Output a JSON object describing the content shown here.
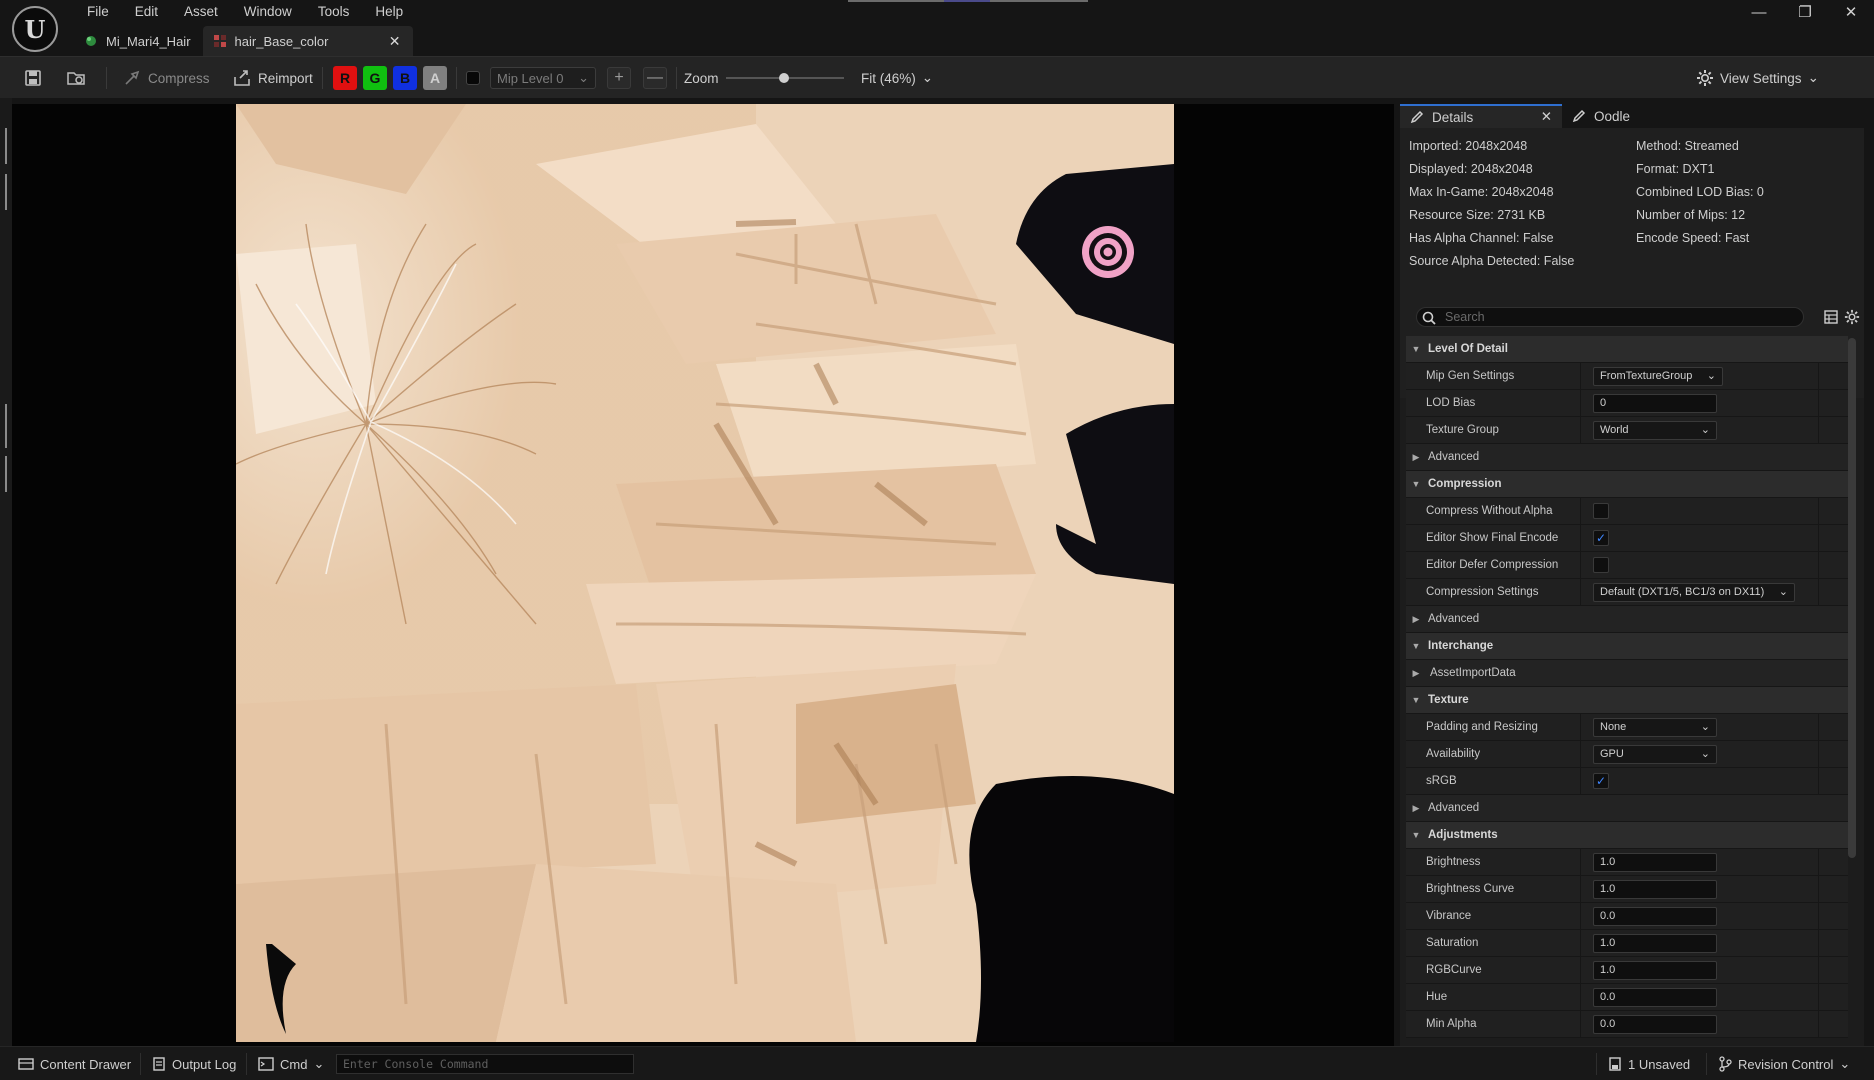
{
  "menu": [
    "File",
    "Edit",
    "Asset",
    "Window",
    "Tools",
    "Help"
  ],
  "tabs": [
    {
      "label": "Mi_Mari4_Hair",
      "active": false
    },
    {
      "label": "hair_Base_color",
      "active": true
    }
  ],
  "toolbar": {
    "compress": "Compress",
    "reimport": "Reimport",
    "channels": [
      "R",
      "G",
      "B",
      "A"
    ],
    "channel_colors": [
      "#e01010",
      "#10c010",
      "#1030e0",
      "#808080"
    ],
    "mip_level": "Mip Level 0",
    "zoom_label": "Zoom",
    "zoom_value": 0.46,
    "fit": "Fit (46%)",
    "view_settings": "View Settings"
  },
  "details_tabs": [
    "Details",
    "Oodle"
  ],
  "stats": {
    "imported": "Imported: 2048x2048",
    "displayed": "Displayed: 2048x2048",
    "max_in_game": "Max In-Game: 2048x2048",
    "resource_size": "Resource Size: 2731 KB",
    "has_alpha": "Has Alpha Channel: False",
    "source_alpha": "Source Alpha Detected: False",
    "method": "Method: Streamed",
    "format": "Format: DXT1",
    "lod_bias": "Combined LOD Bias: 0",
    "num_mips": "Number of Mips: 12",
    "encode_speed": "Encode Speed: Fast"
  },
  "search": {
    "placeholder": "Search"
  },
  "props": {
    "level_of_detail": "Level Of Detail",
    "mip_gen_settings": {
      "label": "Mip Gen Settings",
      "value": "FromTextureGroup"
    },
    "lod_bias": {
      "label": "LOD Bias",
      "value": "0"
    },
    "texture_group": {
      "label": "Texture Group",
      "value": "World"
    },
    "advanced": "Advanced",
    "compression": "Compression",
    "compress_without_alpha": {
      "label": "Compress Without Alpha",
      "checked": false
    },
    "editor_show_final_encode": {
      "label": "Editor Show Final Encode",
      "checked": true
    },
    "editor_defer_compression": {
      "label": "Editor Defer Compression",
      "checked": false
    },
    "compression_settings": {
      "label": "Compression Settings",
      "value": "Default (DXT1/5, BC1/3 on DX11)"
    },
    "interchange": "Interchange",
    "asset_import_data": "AssetImportData",
    "texture": "Texture",
    "padding_and_resizing": {
      "label": "Padding and Resizing",
      "value": "None"
    },
    "availability": {
      "label": "Availability",
      "value": "GPU"
    },
    "srgb": {
      "label": "sRGB",
      "checked": true
    },
    "adjustments": "Adjustments",
    "brightness": {
      "label": "Brightness",
      "value": "1.0"
    },
    "brightness_curve": {
      "label": "Brightness Curve",
      "value": "1.0"
    },
    "vibrance": {
      "label": "Vibrance",
      "value": "0.0"
    },
    "saturation": {
      "label": "Saturation",
      "value": "1.0"
    },
    "rgbcurve": {
      "label": "RGBCurve",
      "value": "1.0"
    },
    "hue": {
      "label": "Hue",
      "value": "0.0"
    },
    "min_alpha": {
      "label": "Min Alpha",
      "value": "0.0"
    }
  },
  "status": {
    "content_drawer": "Content Drawer",
    "output_log": "Output Log",
    "cmd": "Cmd",
    "console_placeholder": "Enter Console Command",
    "unsaved": "1 Unsaved",
    "revision_control": "Revision Control"
  },
  "colors": {
    "accent_blue": "#2f6fd0",
    "check_blue": "#3f86ff",
    "texture_base": "#ecd3b8"
  }
}
